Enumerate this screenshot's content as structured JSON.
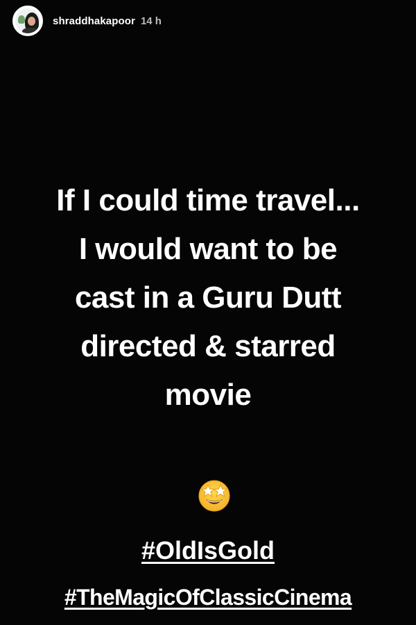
{
  "header": {
    "username": "shraddhakapoor",
    "timestamp": "14 h"
  },
  "story": {
    "lines": [
      "If I could time travel...",
      "I would want to be",
      "cast in a Guru Dutt",
      "directed & starred",
      "movie"
    ],
    "emoji": "star-struck-emoji",
    "hashtags": [
      "#OldIsGold",
      "#TheMagicOfClassicCinema"
    ]
  },
  "colors": {
    "background": "#050505",
    "text": "#ffffff",
    "timestamp": "#bdbdbd",
    "emoji_face": "#f7c631"
  }
}
